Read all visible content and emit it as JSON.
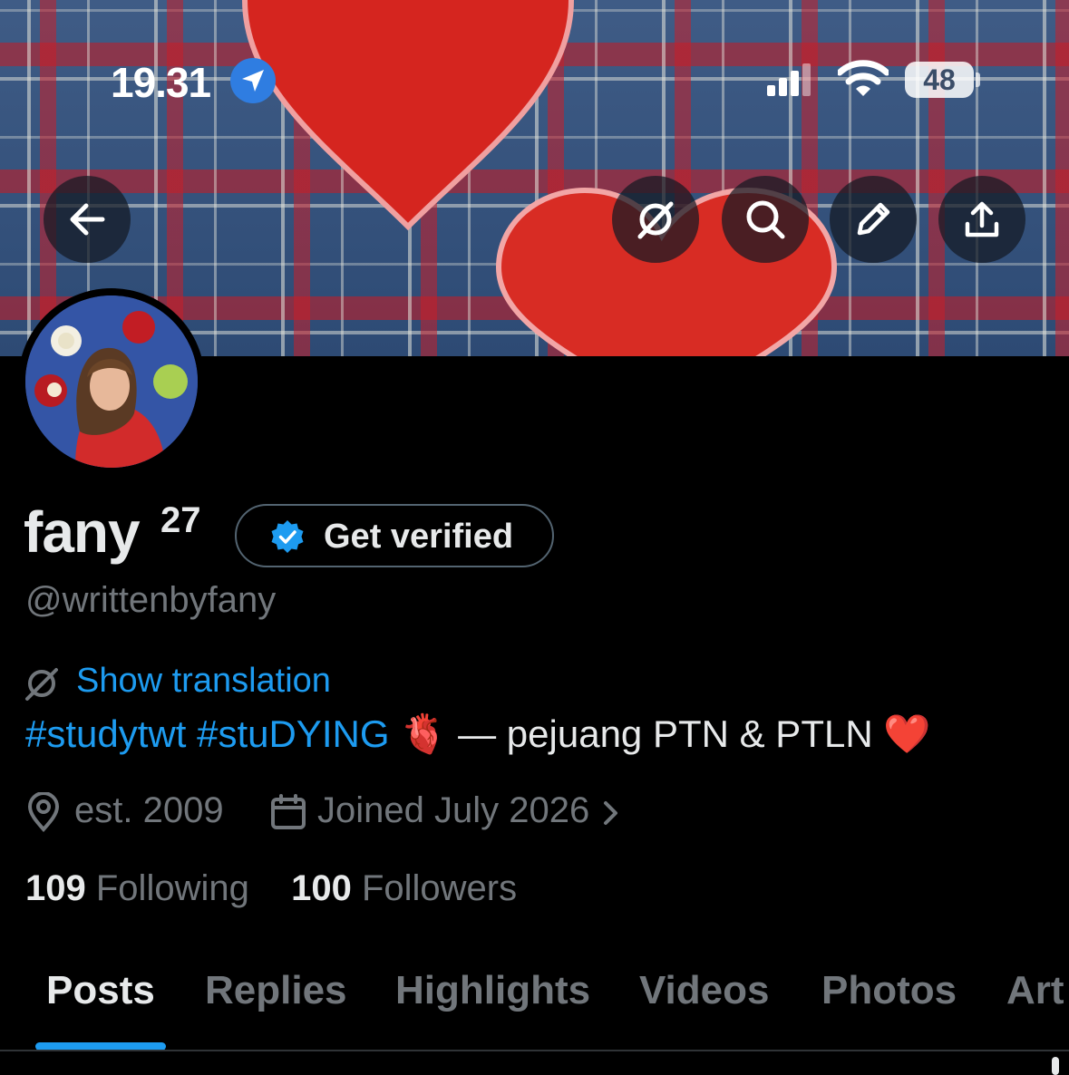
{
  "status_bar": {
    "time": "19.31",
    "battery": "48"
  },
  "profile": {
    "name": "fany",
    "name_superscript": "27",
    "verify_label": "Get verified",
    "handle": "@writtenbyfany",
    "translate_label": "Show translation",
    "bio": {
      "hashtag_1": "#studytwt",
      "hashtag_2": "#stuDYING",
      "anatomical_heart_emoji": "🫀",
      "text": " — pejuang PTN & PTLN ",
      "red_heart_emoji": "❤️"
    },
    "location": "est. 2009",
    "joined": "Joined July 2026",
    "following_count": "109",
    "following_label": "Following",
    "followers_count": "100",
    "followers_label": "Followers"
  },
  "tabs": [
    {
      "label": "Posts",
      "active": true
    },
    {
      "label": "Replies"
    },
    {
      "label": "Highlights"
    },
    {
      "label": "Videos"
    },
    {
      "label": "Photos"
    },
    {
      "label": "Art"
    }
  ],
  "icons": {
    "back": "arrow-left-icon",
    "grok": "grok-icon",
    "search": "search-icon",
    "edit": "pencil-icon",
    "share": "share-icon",
    "location": "location-pin-icon",
    "calendar": "calendar-icon",
    "verified": "verified-badge-icon"
  },
  "colors": {
    "accent": "#1d9bf0",
    "background": "#000000",
    "muted": "#71767b",
    "text": "#e7e9ea"
  }
}
